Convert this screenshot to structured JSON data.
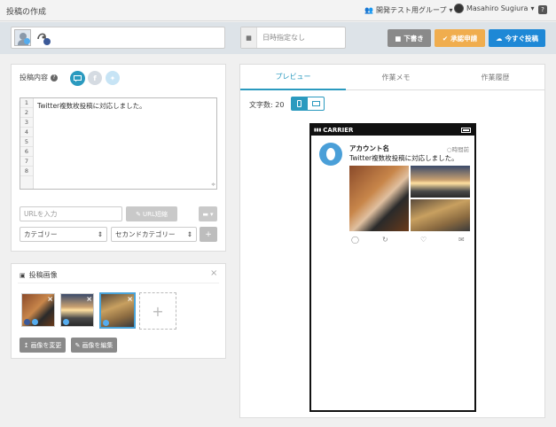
{
  "header": {
    "title": "投稿の作成",
    "group": "開発テスト用グループ",
    "user": "Masahiro Sugiura",
    "help": "?"
  },
  "toolbar": {
    "date_placeholder": "日時指定なし",
    "draft_label": "下書き",
    "approve_label": "承認申請",
    "post_label": "今すぐ投稿"
  },
  "composer": {
    "label": "投稿内容",
    "line_numbers": [
      "1",
      "2",
      "3",
      "4",
      "5",
      "6",
      "7",
      "8"
    ],
    "text": "Twitter複数枚投稿に対応しました。",
    "url_placeholder": "URLを入力",
    "shorten_label": "URL短縮",
    "category_label": "カテゴリー",
    "second_category_label": "セカンドカテゴリー",
    "add_label": "+"
  },
  "images": {
    "label": "投稿画像",
    "change_label": "画像を変更",
    "edit_label": "画像を編集",
    "add_label": "+"
  },
  "preview": {
    "tabs": [
      "プレビュー",
      "作業メモ",
      "作業履歴"
    ],
    "char_count_label": "文字数: 20",
    "carrier": "CARRIER",
    "account_name": "アカウント名",
    "time": "○時間前",
    "tweet_text": "Twitter複数枚投稿に対応しました。"
  },
  "colors": {
    "accent": "#2b9abf",
    "twitter": "#55acee",
    "facebook": "#3b5998",
    "approve": "#f0ad4e",
    "post": "#1e88d6"
  }
}
